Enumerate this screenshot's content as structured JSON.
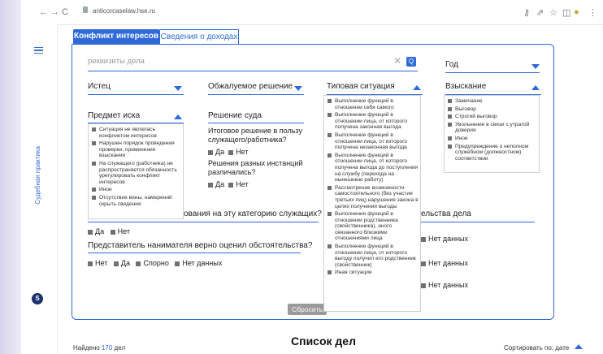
{
  "browser": {
    "url": "anticorcaselaw.hse.ru",
    "nav_icons": [
      "back-icon",
      "forward-icon",
      "reload-icon"
    ]
  },
  "sidebar": {
    "vertical_label": "Судебная практика",
    "badge": "S"
  },
  "tabs": [
    {
      "label": "Конфликт интересов"
    },
    {
      "label": "Сведения о доходах"
    }
  ],
  "search": {
    "placeholder": "реквизиты дела",
    "clear": "✕",
    "button": "Q"
  },
  "filters": {
    "year": "Год",
    "plaintiff": "Истец",
    "appealed": "Обжалуемое решение",
    "typical": "Типовая ситуация",
    "penalty": "Взыскание",
    "subject": "Предмет иска",
    "court": "Решение суда"
  },
  "court_decision": {
    "q1": "Итоговое решение в пользу служащего/работника?",
    "q1_options": [
      "Да",
      "Нет"
    ],
    "q2": "Решения разных инстанций различались?",
    "q2_options": [
      "Да",
      "Нет"
    ]
  },
  "subject_options": [
    "Ситуация не являлась конфликтом интересов",
    "Нарушен порядок проведения проверки, применения взыскания",
    "На служащего (работника) не распространяется обязанность урегулировать конфликт интересов",
    "Иное",
    "Отсутствие вины, намерений скрыть сведения"
  ],
  "typical_options": [
    "Выполнение функций в отношении себя самого",
    "Выполнение функций в отношении лица, от которого получена законная выгода",
    "Выполнение функций в отношении лица, от которого получена незаконная выгода",
    "Выполнение функций в отношении лица, от которого получена выгода до поступления на службу (перехода на нынешнюю работу)",
    "Рассмотрение возможности самостоятельного (без участия третьих лиц) нарушения закона в целях получения выгоды",
    "Выполнение функций в отношении родственника (свойственника), иного связанного близкими отношениями лица",
    "Выполнение функций в отношении лица, от которого выгоду получил его родственник (свойственник)",
    "Иная ситуация"
  ],
  "penalty_options": [
    "Замечание",
    "Выговор",
    "Строгий выговор",
    "Увольнение в связи с утратой доверия",
    "Иное",
    "Предупреждение о неполном служебном (должностном) соответствии"
  ],
  "question_row": {
    "partial": "ования на эту категорию служащих?",
    "options": [
      "Да",
      "Нет"
    ],
    "right_partial": "ельства дела"
  },
  "employer_question": {
    "label": "Представитель нанимателя верно оценил обстоятельства?",
    "options": [
      "Нет",
      "Да",
      "Спорно",
      "Нет данных"
    ]
  },
  "right_options": [
    "Нет данных",
    "Нет данных",
    "Нет данных"
  ],
  "reset_button": "Сбросить",
  "list": {
    "title": "Список дел",
    "found_prefix": "Найдено",
    "found_count": "170",
    "found_suffix": "дел",
    "sort_label": "Сортировать по: дате"
  }
}
